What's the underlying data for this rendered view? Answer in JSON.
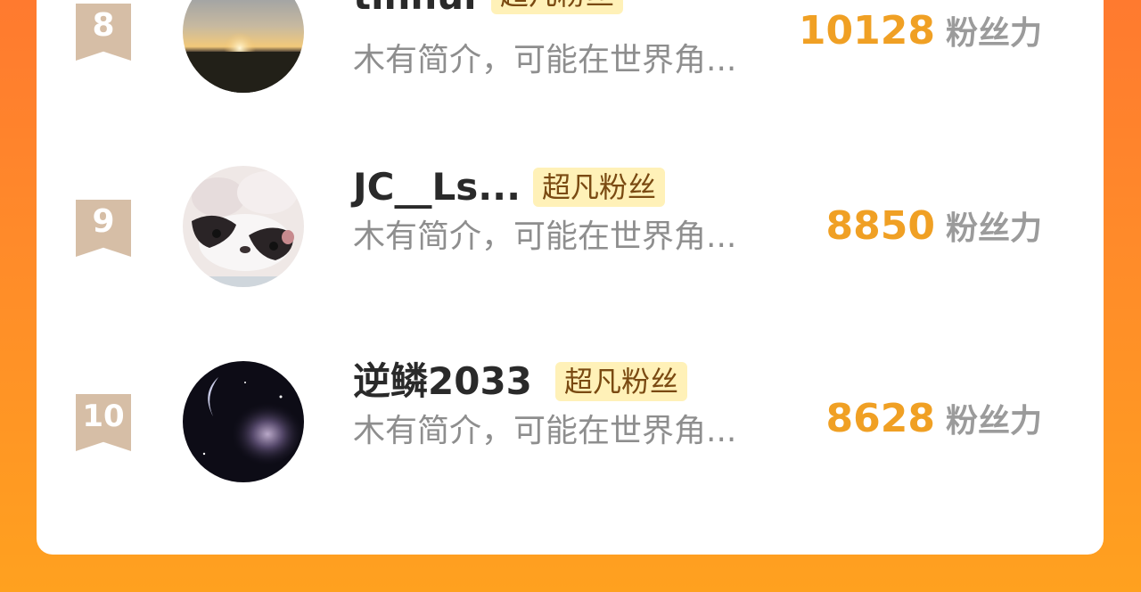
{
  "rows": [
    {
      "rank": "8",
      "name": "tinhui",
      "badge": "超凡粉丝",
      "bio": "木有简介，可能在世界角...",
      "score": "10128",
      "unit": "粉丝力"
    },
    {
      "rank": "9",
      "name": "JC__Ls...",
      "badge": "超凡粉丝",
      "bio": "木有简介，可能在世界角...",
      "score": "8850",
      "unit": "粉丝力"
    },
    {
      "rank": "10",
      "name": "逆鳞2033",
      "badge": "超凡粉丝",
      "bio": "木有简介，可能在世界角...",
      "score": "8628",
      "unit": "粉丝力"
    }
  ],
  "colors": {
    "background_top": "#ff7a2f",
    "background_bottom": "#ffa11f",
    "rank_ribbon": "#d6bea6",
    "badge_bg": "#fff1b8",
    "badge_text": "#7a4a12",
    "score": "#f0a024",
    "unit": "#9b9b9b",
    "bio": "#8e8e8e"
  }
}
